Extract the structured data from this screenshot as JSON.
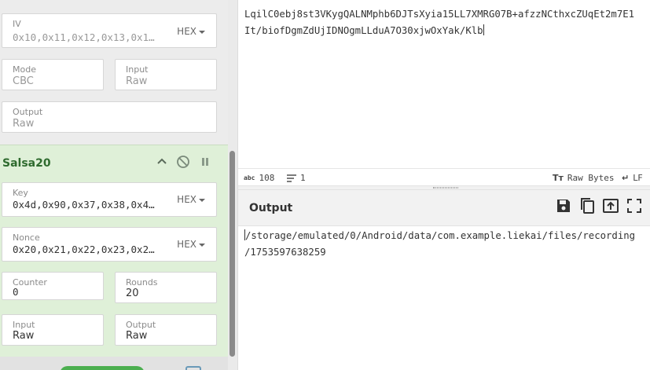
{
  "recipe": {
    "aes_partial": {
      "iv": {
        "label": "IV",
        "value": "0x10,0x11,0x12,0x13,0x1…",
        "format": "HEX"
      },
      "mode": {
        "label": "Mode",
        "value": "CBC"
      },
      "input": {
        "label": "Input",
        "value": "Raw"
      },
      "output": {
        "label": "Output",
        "value": "Raw"
      }
    },
    "salsa20": {
      "title": "Salsa20",
      "key": {
        "label": "Key",
        "value": "0x4d,0x90,0x37,0x38,0x4…",
        "format": "HEX"
      },
      "nonce": {
        "label": "Nonce",
        "value": "0x20,0x21,0x22,0x23,0x2…",
        "format": "HEX"
      },
      "counter": {
        "label": "Counter",
        "value": "0"
      },
      "rounds": {
        "label": "Rounds",
        "value": "20"
      },
      "input": {
        "label": "Input",
        "value": "Raw"
      },
      "output": {
        "label": "Output",
        "value": "Raw"
      }
    }
  },
  "input_pane": {
    "line1": "LqilC0ebj8st3VKygQALNMphb6DJTsXyia15LL7XMRG07B+afzzNCthxcZUqEt2m7E1",
    "line2": "It/biofDgmZdUjIDNOgmLLduA7O30xjwOxYak/Klb"
  },
  "status": {
    "length_icon": "abc",
    "length": "108",
    "lines": "1",
    "encoding_icon": "Tт",
    "encoding": "Raw Bytes",
    "eol": "LF"
  },
  "output_pane": {
    "title": "Output",
    "line1": "/storage/emulated/0/Android/data/com.example.liekai/files/recording",
    "line2": "/1753597638259"
  },
  "colors": {
    "green_op_bg": "#dff0d8",
    "op_title": "#2f6b2f",
    "panel_gray": "#ececec"
  }
}
